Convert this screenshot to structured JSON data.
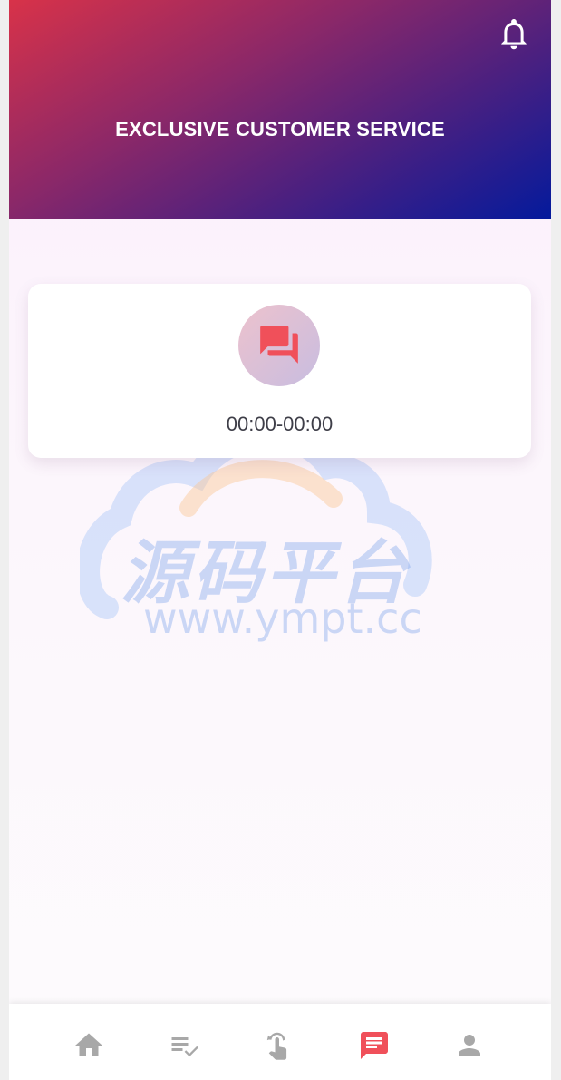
{
  "header": {
    "title": "EXCLUSIVE CUSTOMER SERVICE",
    "icon": "bell-icon"
  },
  "service_card": {
    "icon": "chat-bubbles-icon",
    "hours": "00:00-00:00"
  },
  "watermark": {
    "chinese_text": "源码平台",
    "url": "www.ympt.cc"
  },
  "tabbar": {
    "items": [
      {
        "icon": "home-icon",
        "active": false
      },
      {
        "icon": "task-list-icon",
        "active": false
      },
      {
        "icon": "tap-gesture-icon",
        "active": false
      },
      {
        "icon": "message-icon",
        "active": true
      },
      {
        "icon": "profile-icon",
        "active": false
      }
    ],
    "active_color": "#f0505a",
    "inactive_color": "#a8a8a8"
  },
  "colors": {
    "header_gradient_start": "#d83249",
    "header_gradient_end": "#041a9c",
    "accent": "#f0505a"
  }
}
